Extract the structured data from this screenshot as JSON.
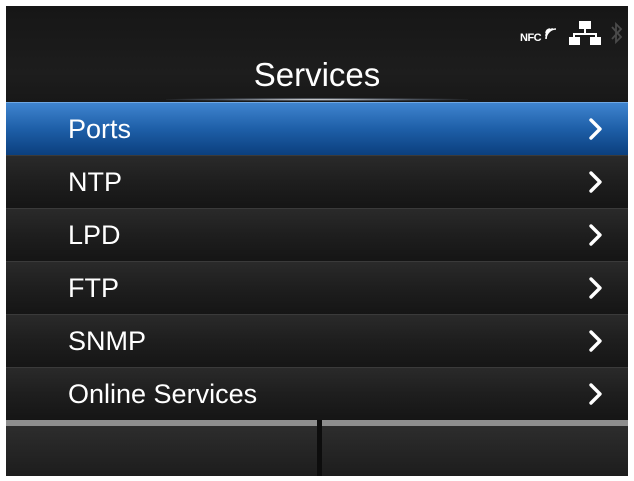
{
  "status_bar": {
    "nfc_label": "NFC",
    "icons": [
      "nfc-icon",
      "network-icon",
      "bluetooth-icon"
    ]
  },
  "header": {
    "title": "Services"
  },
  "menu": {
    "items": [
      {
        "label": "Ports",
        "selected": true
      },
      {
        "label": "NTP",
        "selected": false
      },
      {
        "label": "LPD",
        "selected": false
      },
      {
        "label": "FTP",
        "selected": false
      },
      {
        "label": "SNMP",
        "selected": false
      },
      {
        "label": "Online Services",
        "selected": false
      }
    ]
  },
  "colors": {
    "background": "#1f1f1f",
    "selected": "#1e5fa8",
    "text": "#ffffff",
    "softkey_bar": "#8e8e8e"
  }
}
